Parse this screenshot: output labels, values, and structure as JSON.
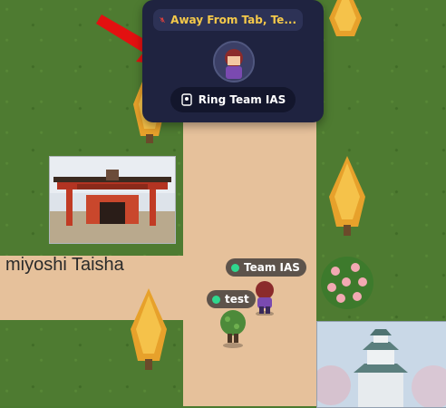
{
  "popup": {
    "status_text": "Away From Tab, Te...",
    "ring_button_label": "Ring Team IAS"
  },
  "map": {
    "location_label": "miyoshi Taisha"
  },
  "avatars": [
    {
      "name": "Team IAS"
    },
    {
      "name": "test"
    }
  ],
  "icons": {
    "muted_mic": "microphone-off-icon",
    "ring": "ring-bell-icon",
    "arrow": "red-arrow"
  },
  "colors": {
    "popup_bg": "#1f2340",
    "status_dot": "#2fd88e",
    "grass": "#4e7b31",
    "path": "#e6c19b",
    "arrow": "#e31010"
  }
}
